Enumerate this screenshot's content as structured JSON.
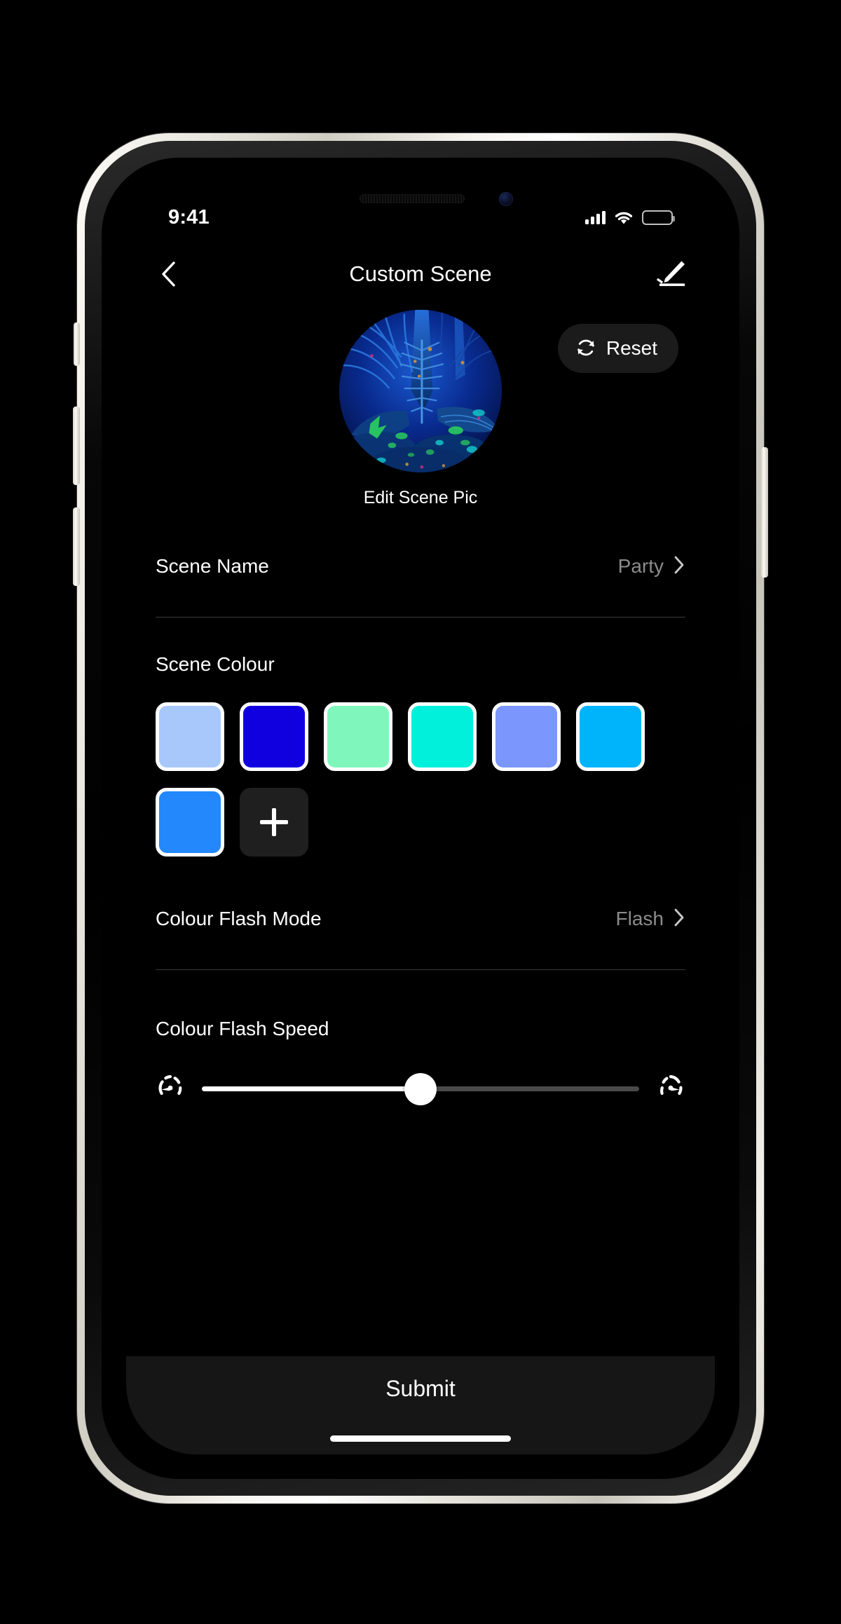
{
  "status_bar": {
    "time": "9:41",
    "cellular_icon": "signal-bars-icon",
    "wifi_icon": "wifi-icon",
    "battery_icon": "battery-full-icon",
    "battery_level": 100
  },
  "nav": {
    "back_icon": "chevron-left-icon",
    "title": "Custom Scene",
    "edit_icon": "pencil-edit-icon"
  },
  "hero": {
    "scene_pic_alt": "blue tropical jungle scene",
    "caption": "Edit Scene Pic",
    "reset_label": "Reset",
    "reset_icon": "refresh-circle-icon"
  },
  "scene_name_row": {
    "label": "Scene Name",
    "value": "Party",
    "chevron_icon": "chevron-right-icon"
  },
  "scene_colour": {
    "label": "Scene Colour",
    "add_icon": "plus-icon",
    "swatches": [
      {
        "name": "swatch-1",
        "hex": "#A8C8FC"
      },
      {
        "name": "swatch-2",
        "hex": "#1000E0"
      },
      {
        "name": "swatch-3",
        "hex": "#7FF7BC"
      },
      {
        "name": "swatch-4",
        "hex": "#00F0DC"
      },
      {
        "name": "swatch-5",
        "hex": "#7B96FC"
      },
      {
        "name": "swatch-6",
        "hex": "#00B4FC"
      },
      {
        "name": "swatch-7",
        "hex": "#2288FC"
      }
    ]
  },
  "flash_mode_row": {
    "label": "Colour Flash Mode",
    "value": "Flash",
    "chevron_icon": "chevron-right-icon"
  },
  "flash_speed": {
    "label": "Colour Flash Speed",
    "min_icon": "speed-slow-gauge-icon",
    "max_icon": "speed-fast-gauge-icon",
    "value_percent": 50
  },
  "bottom": {
    "submit_label": "Submit",
    "home_indicator": "home-indicator"
  }
}
